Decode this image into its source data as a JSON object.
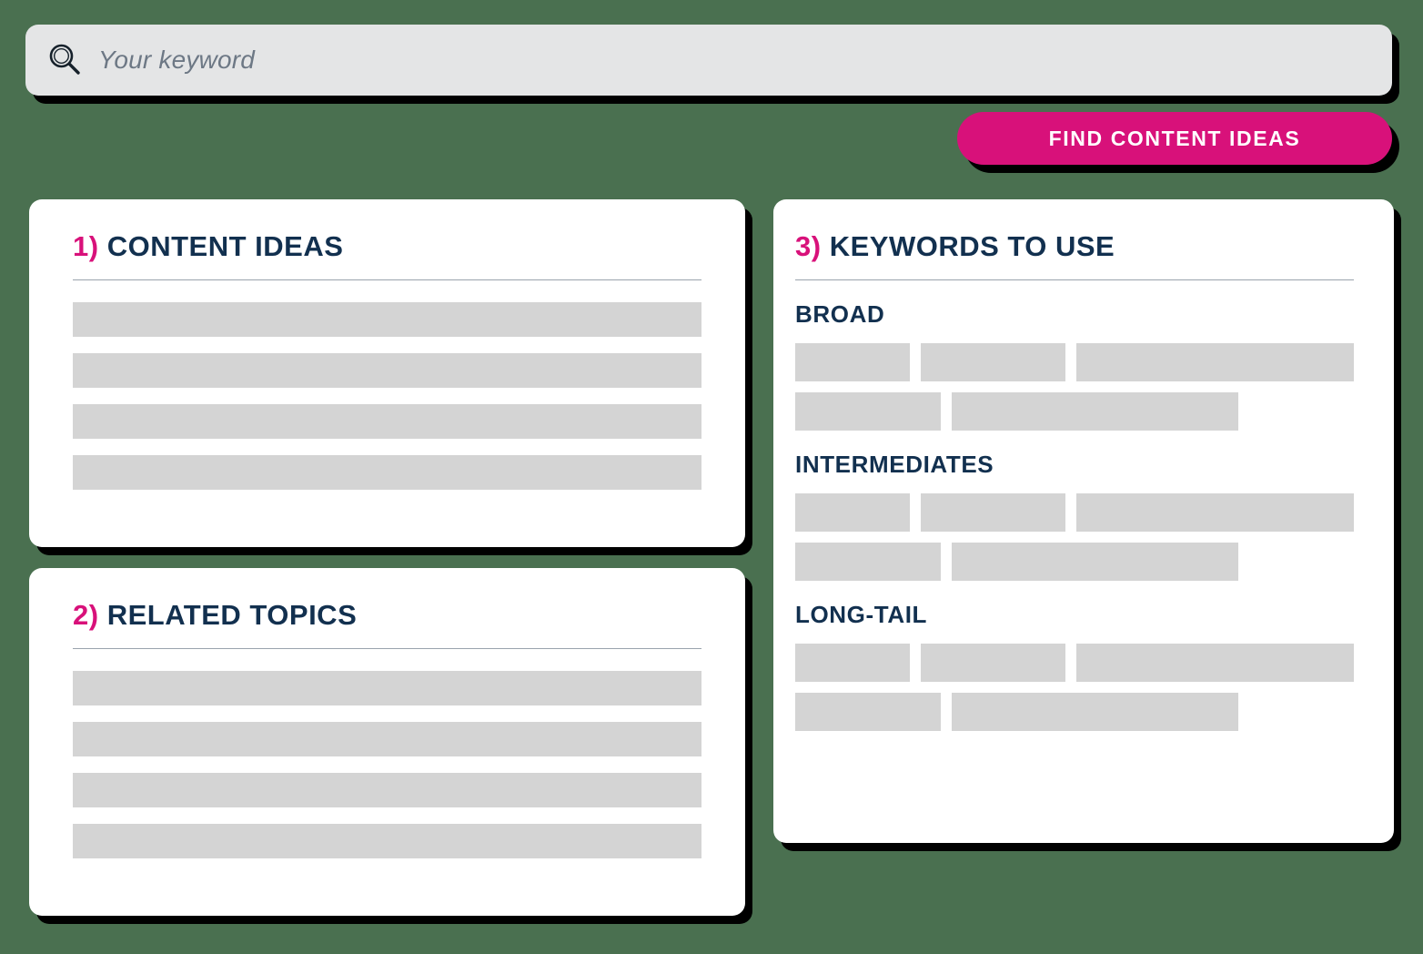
{
  "theme": {
    "background": "#4a7050",
    "accent": "#d8117a",
    "heading": "#12304f",
    "skeleton": "#d4d4d4",
    "card_bg": "#ffffff",
    "search_bg": "#e4e5e6",
    "shadow": "#000000"
  },
  "search": {
    "icon": "search-icon",
    "placeholder": "Your keyword",
    "value": ""
  },
  "actions": {
    "find_button_label": "FIND CONTENT IDEAS"
  },
  "cards": {
    "content_ideas": {
      "number": "1)",
      "title": "CONTENT IDEAS",
      "placeholder_rows": 4
    },
    "related_topics": {
      "number": "2)",
      "title": "RELATED TOPICS",
      "placeholder_rows": 4
    },
    "keywords_to_use": {
      "number": "3)",
      "title": "KEYWORDS TO USE",
      "groups": [
        {
          "label": "BROAD"
        },
        {
          "label": "INTERMEDIATES"
        },
        {
          "label": "LONG-TAIL"
        }
      ]
    }
  }
}
